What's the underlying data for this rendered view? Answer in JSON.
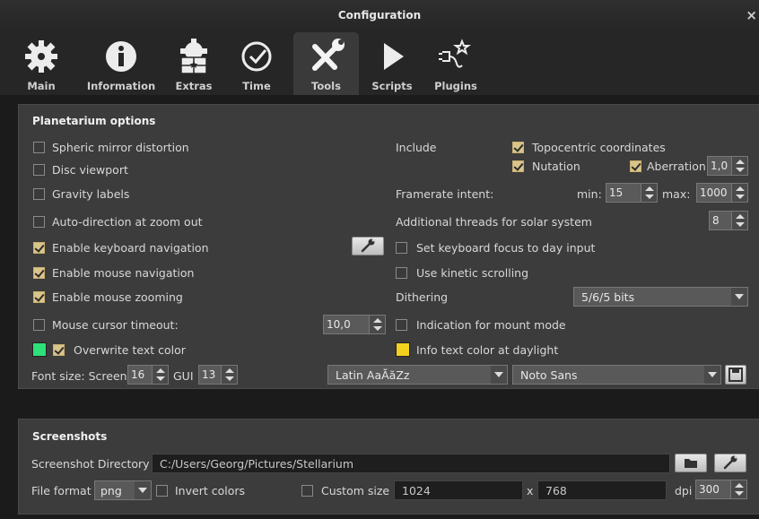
{
  "window": {
    "title": "Configuration",
    "close_glyph": "×"
  },
  "tabs": [
    {
      "label": "Main",
      "icon": "gear-icon"
    },
    {
      "label": "Information",
      "icon": "info-icon"
    },
    {
      "label": "Extras",
      "icon": "extras-gear-icon"
    },
    {
      "label": "Time",
      "icon": "clock-icon"
    },
    {
      "label": "Tools",
      "icon": "tools-icon",
      "active": true
    },
    {
      "label": "Scripts",
      "icon": "play-icon"
    },
    {
      "label": "Plugins",
      "icon": "plug-icon"
    }
  ],
  "planetarium": {
    "title": "Planetarium options",
    "spheric_mirror": {
      "label": "Spheric mirror distortion",
      "checked": false
    },
    "disc_viewport": {
      "label": "Disc viewport",
      "checked": false
    },
    "gravity_labels": {
      "label": "Gravity labels",
      "checked": false
    },
    "auto_direction": {
      "label": "Auto-direction at zoom out",
      "checked": false
    },
    "keyboard_nav": {
      "label": "Enable keyboard navigation",
      "checked": true
    },
    "mouse_nav": {
      "label": "Enable mouse navigation",
      "checked": true
    },
    "mouse_zoom": {
      "label": "Enable mouse zooming",
      "checked": true
    },
    "mouse_cursor_timeout": {
      "label": "Mouse cursor timeout:",
      "checked": false,
      "value": "10,0"
    },
    "overwrite_text_color": {
      "label": "Overwrite text color",
      "checked": true,
      "color": "#2ee07a"
    },
    "font_size": {
      "label": "Font size: Screen",
      "screen_value": "16",
      "gui_label": "GUI",
      "gui_value": "13"
    },
    "include_label": "Include",
    "topocentric": {
      "label": "Topocentric coordinates",
      "checked": true
    },
    "nutation": {
      "label": "Nutation",
      "checked": true
    },
    "aberration": {
      "label": "Aberration",
      "checked": true,
      "value": "1,0"
    },
    "framerate": {
      "label": "Framerate intent:",
      "min_label": "min:",
      "min_value": "15",
      "max_label": "max:",
      "max_value": "1000"
    },
    "threads": {
      "label": "Additional threads for solar system",
      "value": "8"
    },
    "keyboard_focus": {
      "label": "Set keyboard focus to day input",
      "checked": false
    },
    "kinetic_scroll": {
      "label": "Use kinetic scrolling",
      "checked": false
    },
    "dithering": {
      "label": "Dithering",
      "value": "5/6/5 bits"
    },
    "mount_mode": {
      "label": "Indication for mount mode",
      "checked": false
    },
    "info_daylight": {
      "label": "Info text color at daylight",
      "color": "#f2d21e"
    },
    "font_script": "Latin  AaĂăZz",
    "font_family": "Noto Sans"
  },
  "screenshots": {
    "title": "Screenshots",
    "dir_label": "Screenshot Directory",
    "dir_value": "C:/Users/Georg/Pictures/Stellarium",
    "format_label": "File format",
    "format_value": "png",
    "invert": {
      "label": "Invert colors",
      "checked": false
    },
    "custom_size": {
      "label": "Custom size",
      "checked": false
    },
    "width": "1024",
    "x_label": "x",
    "height": "768",
    "dpi_label": "dpi",
    "dpi_value": "300"
  }
}
